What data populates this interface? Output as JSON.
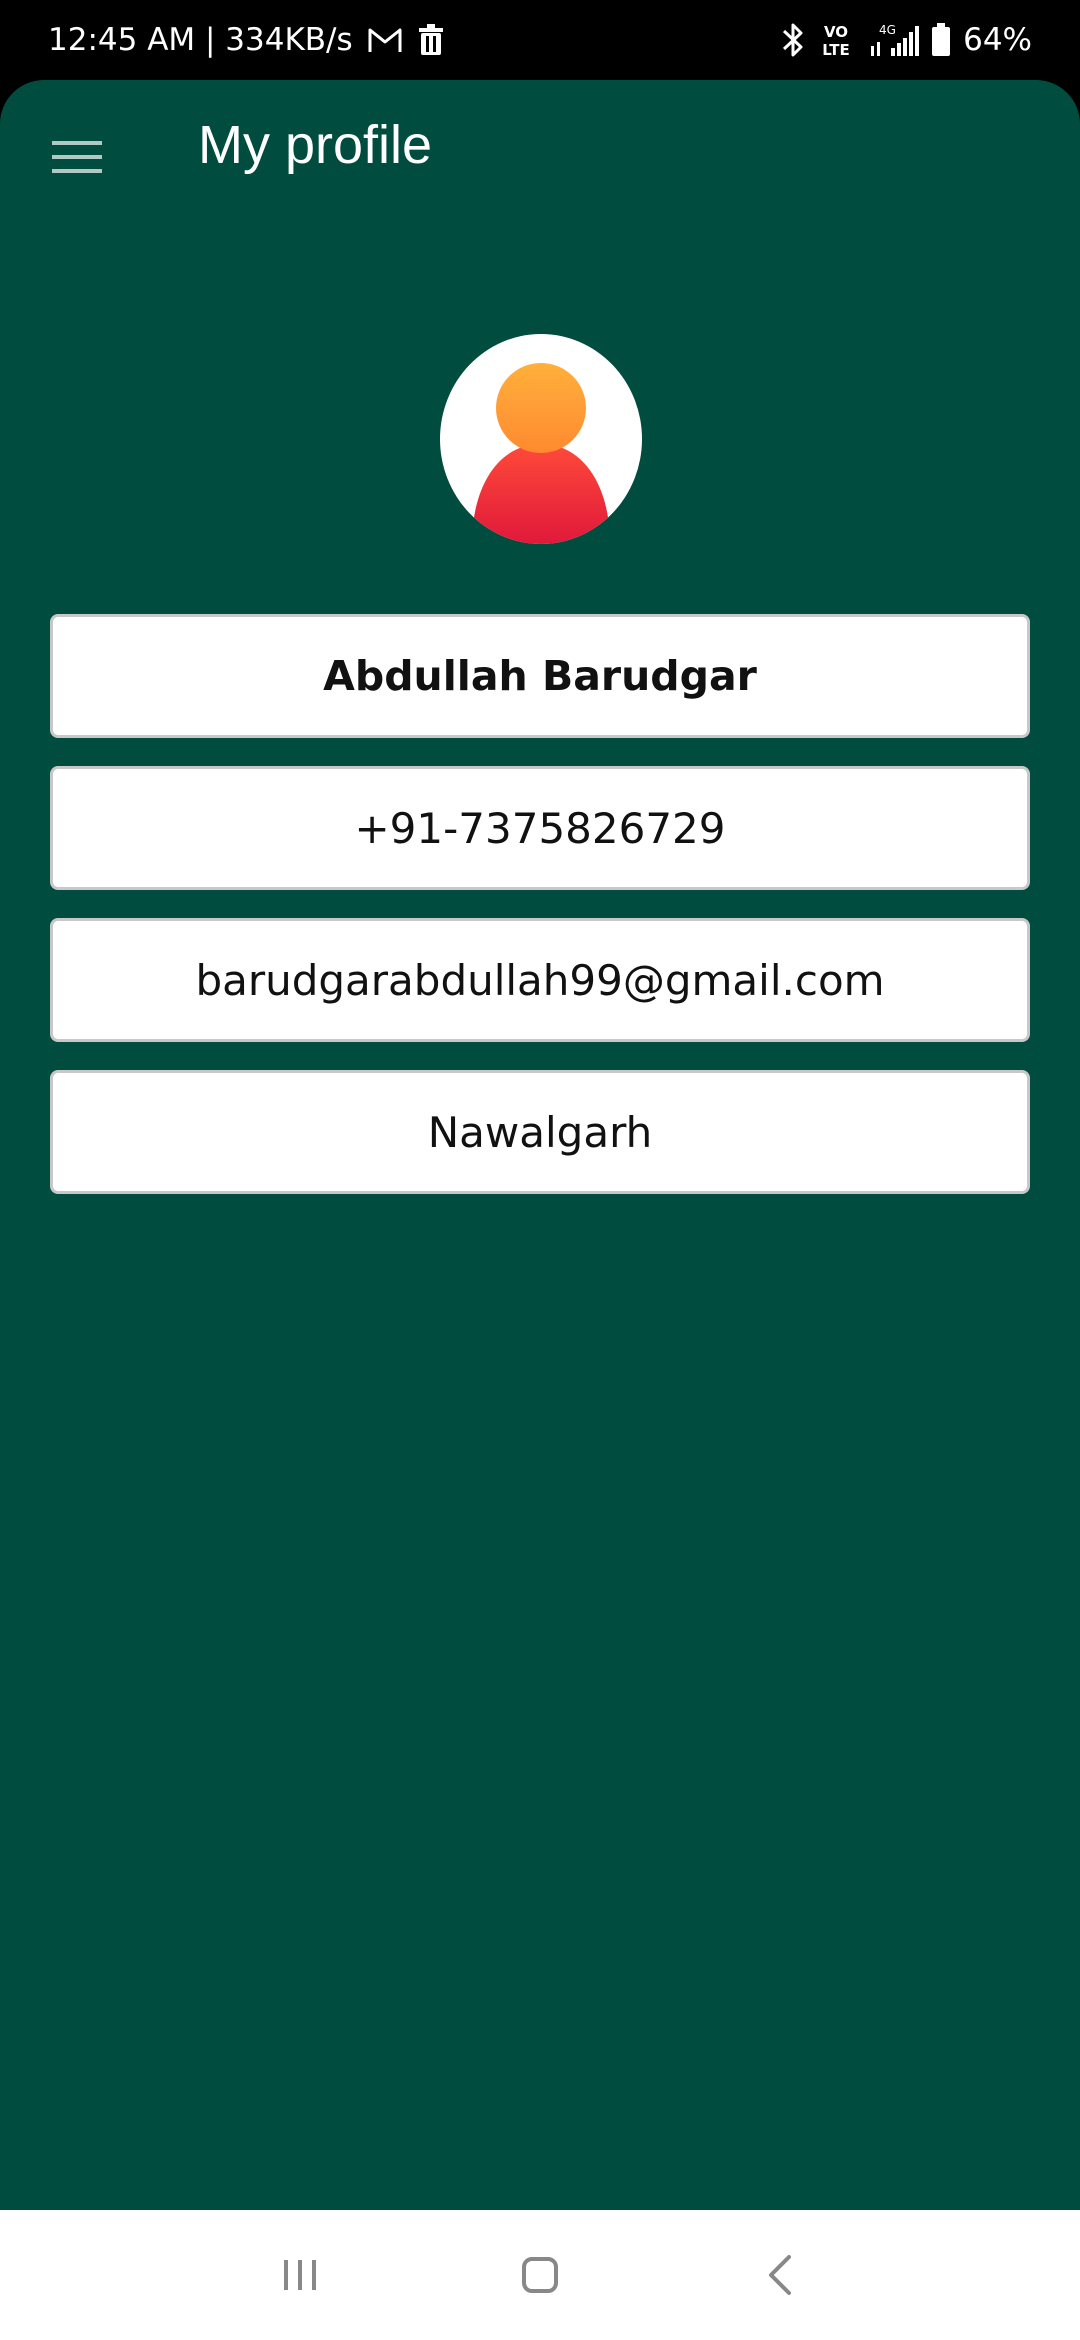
{
  "status_bar": {
    "time_and_speed": "12:45 AM | 334KB/s",
    "network": "4G",
    "volte": "VO\nLTE",
    "battery": "64%"
  },
  "toolbar": {
    "title": "My profile"
  },
  "profile": {
    "name": "Abdullah Barudgar",
    "phone": "+91-7375826729",
    "email": "barudgarabdullah99@gmail.com",
    "city": "Nawalgarh"
  },
  "colors": {
    "app_background": "#004d40",
    "avatar_head": "#ffab40",
    "avatar_body": "#e91e3a"
  },
  "icons": {
    "menu": "hamburger-icon",
    "avatar": "person-icon",
    "nav_recents": "recents-icon",
    "nav_home": "home-icon",
    "nav_back": "back-icon"
  }
}
